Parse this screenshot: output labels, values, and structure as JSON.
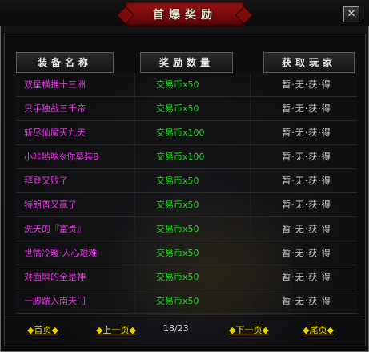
{
  "window": {
    "title": "首爆奖励",
    "close_label": "✕"
  },
  "table": {
    "headers": [
      "装备名称",
      "奖励数量",
      "获取玩家"
    ],
    "rows": [
      {
        "name": "双星横推十三洲",
        "reward": "交易币x50",
        "player": "暂·无·获·得"
      },
      {
        "name": "只手独战三千帝",
        "reward": "交易币x50",
        "player": "暂·无·获·得"
      },
      {
        "name": "斩尽仙魔灭九天",
        "reward": "交易币x100",
        "player": "暂·无·获·得"
      },
      {
        "name": "小咔哟咪※你莫装B",
        "reward": "交易币x100",
        "player": "暂·无·获·得"
      },
      {
        "name": "拜登又败了",
        "reward": "交易币x50",
        "player": "暂·无·获·得"
      },
      {
        "name": "特朗普又赢了",
        "reward": "交易币x50",
        "player": "暂·无·获·得"
      },
      {
        "name": "洗天的『富贵』",
        "reward": "交易币x50",
        "player": "暂·无·获·得"
      },
      {
        "name": "世情冷暖·人心艰难",
        "reward": "交易币x50",
        "player": "暂·无·获·得"
      },
      {
        "name": "对面瞬的全是神",
        "reward": "交易币x50",
        "player": "暂·无·获·得"
      },
      {
        "name": "一脚踹入南天门",
        "reward": "交易币x50",
        "player": "暂·无·获·得"
      }
    ]
  },
  "pager": {
    "first": "◆首页◆",
    "prev": "◆上一页◆",
    "info": "18/23",
    "next": "◆下一页◆",
    "last": "◆尾页◆"
  },
  "colors": {
    "item_name": "#e038e0",
    "reward": "#26d026",
    "player": "#cfcfcf",
    "pager_link": "#e8d300"
  }
}
